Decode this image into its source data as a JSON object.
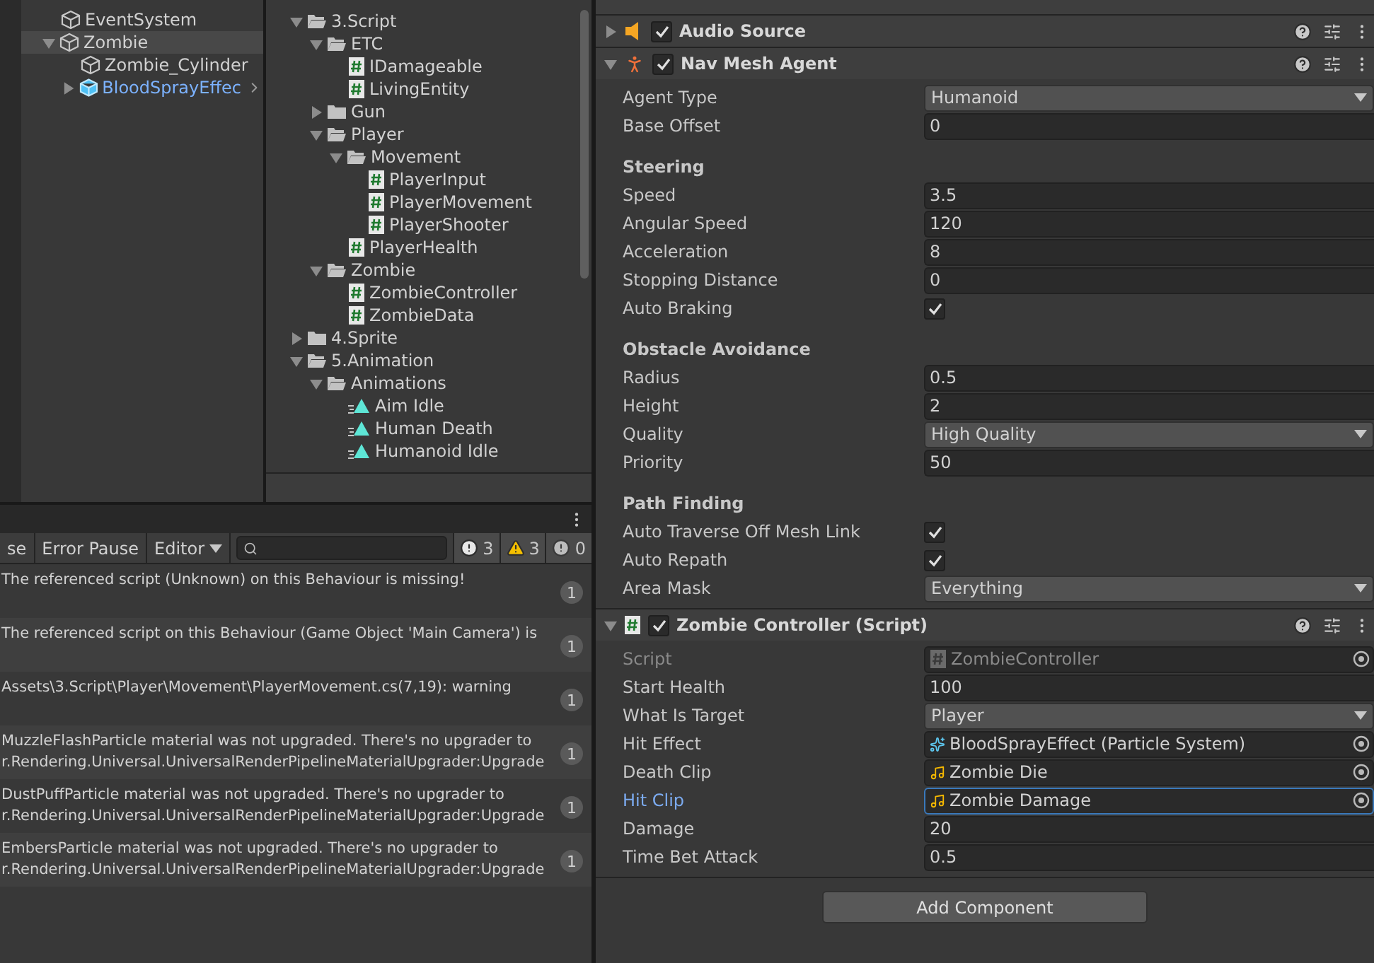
{
  "hierarchy": {
    "items": [
      {
        "label": "EventSystem",
        "kind": "object",
        "selected": false
      },
      {
        "label": "Zombie",
        "kind": "object",
        "selected": true,
        "expanded": true,
        "children": [
          {
            "label": "Zombie_Cylinder",
            "kind": "object",
            "selected": false
          },
          {
            "label": "BloodSprayEffec",
            "kind": "prefab",
            "selected": false,
            "expanded": false
          }
        ]
      }
    ]
  },
  "project": {
    "items": [
      {
        "label": "3.Script",
        "kind": "folder",
        "expanded": true,
        "children": [
          {
            "label": "ETC",
            "kind": "folder",
            "expanded": true,
            "children": [
              {
                "label": "IDamageable",
                "kind": "script"
              },
              {
                "label": "LivingEntity",
                "kind": "script"
              }
            ]
          },
          {
            "label": "Gun",
            "kind": "folder",
            "expanded": false
          },
          {
            "label": "Player",
            "kind": "folder",
            "expanded": true,
            "children": [
              {
                "label": "Movement",
                "kind": "folder",
                "expanded": true,
                "children": [
                  {
                    "label": "PlayerInput",
                    "kind": "script"
                  },
                  {
                    "label": "PlayerMovement",
                    "kind": "script"
                  },
                  {
                    "label": "PlayerShooter",
                    "kind": "script"
                  }
                ]
              },
              {
                "label": "PlayerHealth",
                "kind": "script"
              }
            ]
          },
          {
            "label": "Zombie",
            "kind": "folder",
            "expanded": true,
            "children": [
              {
                "label": "ZombieController",
                "kind": "script"
              },
              {
                "label": "ZombieData",
                "kind": "script"
              }
            ]
          }
        ]
      },
      {
        "label": "4.Sprite",
        "kind": "folder",
        "expanded": false
      },
      {
        "label": "5.Animation",
        "kind": "folder",
        "expanded": true,
        "children": [
          {
            "label": "Animations",
            "kind": "folder",
            "expanded": true,
            "children": [
              {
                "label": "Aim Idle",
                "kind": "animation"
              },
              {
                "label": "Human Death",
                "kind": "animation"
              },
              {
                "label": "Humanoid Idle",
                "kind": "animation"
              }
            ]
          }
        ]
      }
    ]
  },
  "console": {
    "buttons": [
      {
        "label": "se",
        "dropdown": false
      },
      {
        "label": "Error Pause",
        "dropdown": false
      },
      {
        "label": "Editor",
        "dropdown": true
      }
    ],
    "counts": [
      {
        "kind": "info",
        "count": "3"
      },
      {
        "kind": "warning",
        "count": "3"
      },
      {
        "kind": "error",
        "count": "0"
      }
    ],
    "messages": [
      {
        "lines": [
          "The referenced script (Unknown) on this Behaviour is missing!"
        ],
        "count": "1"
      },
      {
        "lines": [
          "The referenced script on this Behaviour (Game Object 'Main Camera') is"
        ],
        "count": "1"
      },
      {
        "lines": [
          "Assets\\3.Script\\Player\\Movement\\PlayerMovement.cs(7,19): warning"
        ],
        "count": "1"
      },
      {
        "lines": [
          "MuzzleFlashParticle material was not upgraded. There's no upgrader to",
          "r.Rendering.Universal.UniversalRenderPipelineMaterialUpgrader:Upgrade"
        ],
        "count": "1"
      },
      {
        "lines": [
          "DustPuffParticle material was not upgraded. There's no upgrader to",
          "r.Rendering.Universal.UniversalRenderPipelineMaterialUpgrader:Upgrade"
        ],
        "count": "1"
      },
      {
        "lines": [
          "EmbersParticle material was not upgraded. There's no upgrader to",
          "r.Rendering.Universal.UniversalRenderPipelineMaterialUpgrader:Upgrade"
        ],
        "count": "1"
      }
    ]
  },
  "inspector": {
    "components": [
      {
        "title": "Audio Source",
        "kind": "audio_source",
        "enabled": true,
        "expanded": false
      },
      {
        "title": "Nav Mesh Agent",
        "kind": "nav_mesh_agent",
        "enabled": true,
        "expanded": true,
        "properties": [
          {
            "kind": "dropdown",
            "label": "Agent Type",
            "value": "Humanoid"
          },
          {
            "kind": "number",
            "label": "Base Offset",
            "value": "0"
          },
          {
            "kind": "heading",
            "label": "Steering"
          },
          {
            "kind": "number",
            "label": "Speed",
            "value": "3.5"
          },
          {
            "kind": "number",
            "label": "Angular Speed",
            "value": "120"
          },
          {
            "kind": "number",
            "label": "Acceleration",
            "value": "8"
          },
          {
            "kind": "number",
            "label": "Stopping Distance",
            "value": "0"
          },
          {
            "kind": "checkbox",
            "label": "Auto Braking",
            "checked": true
          },
          {
            "kind": "heading",
            "label": "Obstacle Avoidance"
          },
          {
            "kind": "number",
            "label": "Radius",
            "value": "0.5"
          },
          {
            "kind": "number",
            "label": "Height",
            "value": "2"
          },
          {
            "kind": "dropdown",
            "label": "Quality",
            "value": "High Quality"
          },
          {
            "kind": "number",
            "label": "Priority",
            "value": "50"
          },
          {
            "kind": "heading",
            "label": "Path Finding"
          },
          {
            "kind": "checkbox",
            "label": "Auto Traverse Off Mesh Link",
            "checked": true
          },
          {
            "kind": "checkbox",
            "label": "Auto Repath",
            "checked": true
          },
          {
            "kind": "dropdown",
            "label": "Area Mask",
            "value": "Everything"
          }
        ]
      },
      {
        "title": "Zombie Controller (Script)",
        "kind": "script",
        "enabled": true,
        "expanded": true,
        "properties": [
          {
            "kind": "script_ref",
            "label": "Script",
            "value": "ZombieController",
            "disabled": true,
            "focused": false
          },
          {
            "kind": "number",
            "label": "Start Health",
            "value": "100"
          },
          {
            "kind": "dropdown",
            "label": "What Is Target",
            "value": "Player"
          },
          {
            "kind": "particle_ref",
            "label": "Hit Effect",
            "value": "BloodSprayEffect (Particle System)",
            "disabled": false,
            "focused": false
          },
          {
            "kind": "audio_ref",
            "label": "Death Clip",
            "value": "Zombie Die",
            "disabled": false,
            "focused": false
          },
          {
            "kind": "audio_ref",
            "label": "Hit Clip",
            "value": "Zombie Damage",
            "disabled": false,
            "focused": true
          },
          {
            "kind": "number",
            "label": "Damage",
            "value": "20"
          },
          {
            "kind": "number",
            "label": "Time Bet Attack",
            "value": "0.5"
          }
        ]
      }
    ],
    "add_button": "Add Component"
  }
}
